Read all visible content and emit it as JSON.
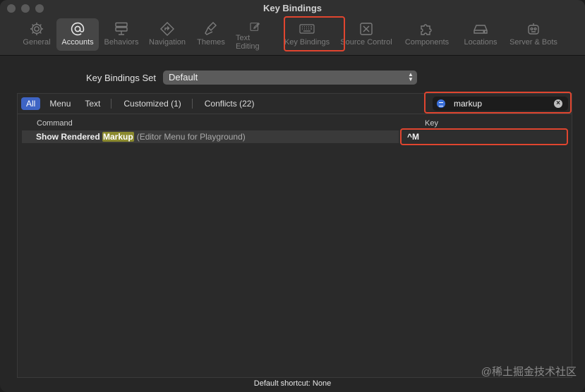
{
  "window": {
    "title": "Key Bindings"
  },
  "toolbar": {
    "tabs": [
      {
        "label": "General",
        "icon": "gear-icon"
      },
      {
        "label": "Accounts",
        "icon": "at-icon"
      },
      {
        "label": "Behaviors",
        "icon": "behaviors-icon"
      },
      {
        "label": "Navigation",
        "icon": "navigation-icon"
      },
      {
        "label": "Themes",
        "icon": "brush-icon"
      },
      {
        "label": "Text Editing",
        "icon": "pencil-square-icon"
      },
      {
        "label": "Key Bindings",
        "icon": "keyboard-icon"
      },
      {
        "label": "Source Control",
        "icon": "source-control-icon"
      },
      {
        "label": "Components",
        "icon": "puzzle-icon"
      },
      {
        "label": "Locations",
        "icon": "drive-icon"
      },
      {
        "label": "Server & Bots",
        "icon": "robot-icon"
      }
    ],
    "selected": "Accounts"
  },
  "key_bindings_set": {
    "label": "Key Bindings Set",
    "value": "Default"
  },
  "filters": {
    "all": "All",
    "menu": "Menu",
    "text": "Text",
    "customized": "Customized (1)",
    "conflicts": "Conflicts (22)"
  },
  "search": {
    "value": "markup"
  },
  "table": {
    "headers": {
      "command": "Command",
      "key": "Key"
    },
    "rows": [
      {
        "command_prefix": "Show Rendered ",
        "command_match": "Markup",
        "context": "(Editor Menu for Playground)",
        "key": "^M"
      }
    ]
  },
  "footer": {
    "text": "Default shortcut: None"
  },
  "watermark": "@稀土掘金技术社区",
  "colors": {
    "highlight": "#e0452f",
    "accent": "#3e64c4",
    "match": "#8b8a2e"
  }
}
